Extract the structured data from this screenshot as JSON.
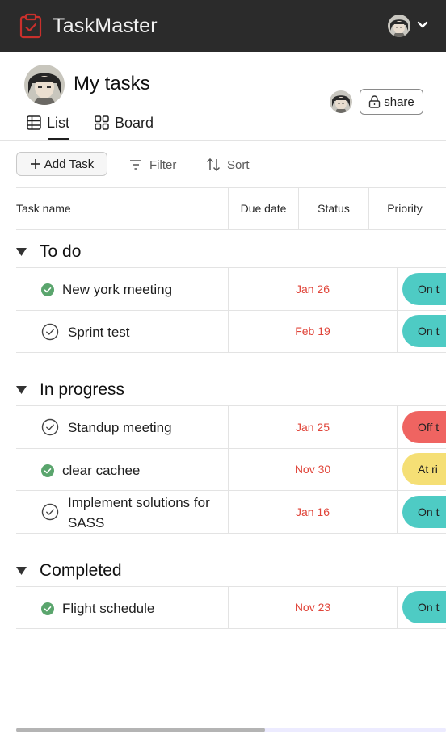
{
  "app": {
    "title": "TaskMaster"
  },
  "page": {
    "title": "My tasks"
  },
  "share": {
    "label": "share"
  },
  "views": [
    {
      "label": "List",
      "active": true
    },
    {
      "label": "Board",
      "active": false
    }
  ],
  "toolbar": {
    "add_label": "Add Task",
    "filter_label": "Filter",
    "sort_label": "Sort"
  },
  "columns": [
    "Task name",
    "Due date",
    "Status",
    "Priority"
  ],
  "groups": [
    {
      "title": "To do",
      "tasks": [
        {
          "name": "New york meeting",
          "completed": true,
          "due": "Jan 26",
          "status": "On t",
          "status_color": "#4ecbc4"
        },
        {
          "name": "Sprint test",
          "completed": false,
          "due": "Feb 19",
          "status": "On t",
          "status_color": "#4ecbc4"
        }
      ]
    },
    {
      "title": "In progress",
      "tasks": [
        {
          "name": "Standup meeting",
          "completed": false,
          "due": "Jan 25",
          "status": "Off t",
          "status_color": "#ef6461"
        },
        {
          "name": "clear cachee",
          "completed": true,
          "due": "Nov 30",
          "status": "At ri",
          "status_color": "#f5df75"
        },
        {
          "name_lines": [
            "Implement solutions for",
            "SASS"
          ],
          "completed": false,
          "due": "Jan 16",
          "status": "On t",
          "status_color": "#4ecbc4"
        }
      ]
    },
    {
      "title": "Completed",
      "tasks": [
        {
          "name": "Flight schedule",
          "completed": true,
          "due": "Nov 23",
          "status": "On t",
          "status_color": "#4ecbc4"
        }
      ]
    }
  ],
  "icons": {
    "logo": "clipboard-check-icon",
    "user": "user-avatar",
    "menu": "chevron-down-icon",
    "lock": "lock-icon",
    "list": "table-icon",
    "board": "grid-icon",
    "add": "plus-icon",
    "filter": "filter-icon",
    "sort": "sort-icon",
    "collapse": "caret-down-icon",
    "done": "check-circle-filled-icon",
    "todo": "check-circle-outline-icon"
  },
  "colors": {
    "appbar": "#2b2b2b",
    "brand_red": "#e0453a",
    "done_green": "#5aa56d",
    "accent_teal": "#4ecbc4"
  }
}
